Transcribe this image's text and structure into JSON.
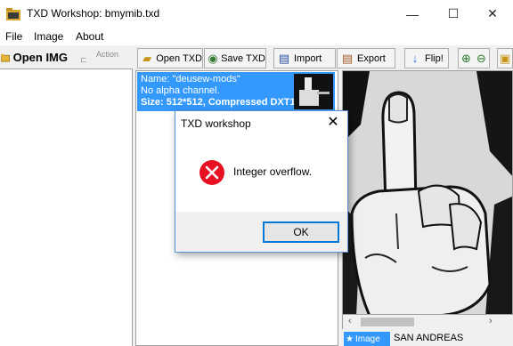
{
  "window": {
    "title": "TXD Workshop: bmymib.txd",
    "controls": {
      "minimize": "—",
      "maximize": "☐",
      "close": "✕"
    }
  },
  "menu": {
    "items": [
      "File",
      "Image",
      "About"
    ]
  },
  "left_panel": {
    "open_img_label": "Open IMG",
    "action_label": "Action"
  },
  "toolbar": {
    "open_txd": "Open TXD",
    "save_txd": "Save TXD",
    "import": "Import",
    "export": "Export",
    "flip": "Flip!"
  },
  "texture_list": {
    "selected": {
      "name": "Name: \"deusew-mods\"",
      "alpha": "No alpha channel.",
      "size": "Size: 512*512, Compressed DXT1"
    }
  },
  "preview": {
    "status_tab": "Image",
    "game": "SAN ANDREAS"
  },
  "dialog": {
    "title": "TXD workshop",
    "message": "Integer overflow.",
    "ok_label": "OK",
    "close_glyph": "✕"
  },
  "colors": {
    "selection": "#3399ff",
    "error_red": "#e81123",
    "focus_blue": "#0078d7"
  },
  "icons": {
    "app": "txd-folder-icon",
    "open_img": "folder-icon",
    "open_txd": "folder-icon",
    "save_txd": "disc-icon",
    "import": "import-icon",
    "export": "export-icon",
    "flip": "down-arrow-icon",
    "error": "error-icon"
  }
}
